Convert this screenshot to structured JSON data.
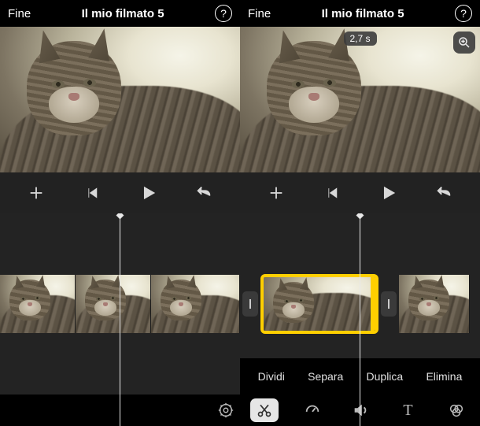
{
  "left": {
    "nav": {
      "back": "Fine",
      "title": "Il mio filmato 5"
    },
    "toolbar": {
      "settings_icon": "gear"
    }
  },
  "right": {
    "nav": {
      "back": "Fine",
      "title": "Il mio filmato 5"
    },
    "preview": {
      "duration_badge": "2,7 s"
    },
    "actions": {
      "split": "Dividi",
      "detach": "Separa",
      "duplicate": "Duplica",
      "delete": "Elimina"
    },
    "tools": {
      "cut": "scissors",
      "speed": "speedometer",
      "volume": "speaker",
      "text": "T",
      "filters": "overlap-circles"
    }
  }
}
